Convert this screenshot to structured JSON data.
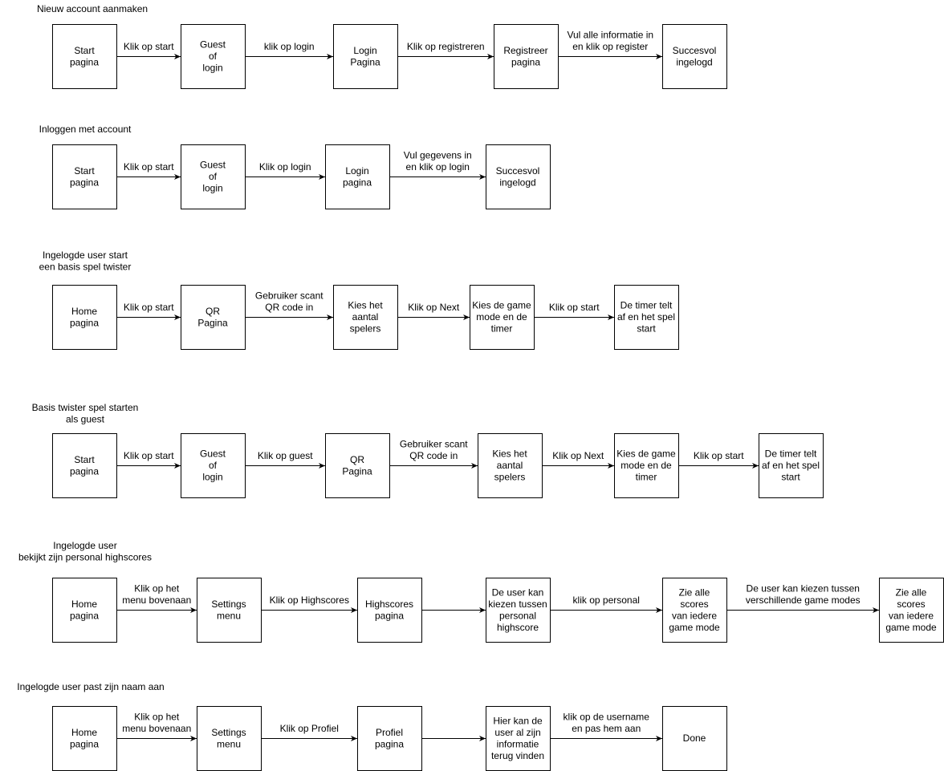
{
  "colors": {
    "stroke": "#000000",
    "box_fill": "#ffffff",
    "text": "#000000",
    "background": "#ffffff"
  },
  "flows": [
    {
      "id": "new-account",
      "title": [
        "Nieuw account aanmaken"
      ],
      "nodes": [
        {
          "id": "start",
          "label": [
            "Start",
            "pagina"
          ]
        },
        {
          "id": "guest-login",
          "label": [
            "Guest",
            "of",
            "login"
          ]
        },
        {
          "id": "login-page",
          "label": [
            "Login",
            "Pagina"
          ]
        },
        {
          "id": "register-page",
          "label": [
            "Registreer",
            "pagina"
          ]
        },
        {
          "id": "logged-in",
          "label": [
            "Succesvol",
            "ingelogd"
          ]
        }
      ],
      "edges": [
        {
          "from": "start",
          "to": "guest-login",
          "label": [
            "Klik op start"
          ]
        },
        {
          "from": "guest-login",
          "to": "login-page",
          "label": [
            "klik op login"
          ]
        },
        {
          "from": "login-page",
          "to": "register-page",
          "label": [
            "Klik op registreren"
          ]
        },
        {
          "from": "register-page",
          "to": "logged-in",
          "label": [
            "Vul alle informatie in",
            "en klik op register"
          ]
        }
      ]
    },
    {
      "id": "login-account",
      "title": [
        "Inloggen met account"
      ],
      "nodes": [
        {
          "id": "start",
          "label": [
            "Start",
            "pagina"
          ]
        },
        {
          "id": "guest-login",
          "label": [
            "Guest",
            "of",
            "login"
          ]
        },
        {
          "id": "login-page",
          "label": [
            "Login",
            "pagina"
          ]
        },
        {
          "id": "logged-in",
          "label": [
            "Succesvol",
            "ingelogd"
          ]
        }
      ],
      "edges": [
        {
          "from": "start",
          "to": "guest-login",
          "label": [
            "Klik op start"
          ]
        },
        {
          "from": "guest-login",
          "to": "login-page",
          "label": [
            "Klik op login"
          ]
        },
        {
          "from": "login-page",
          "to": "logged-in",
          "label": [
            "Vul gegevens in",
            "en klik op login"
          ]
        }
      ]
    },
    {
      "id": "user-start-game",
      "title": [
        "Ingelogde user start",
        "een basis spel twister"
      ],
      "nodes": [
        {
          "id": "home",
          "label": [
            "Home",
            "pagina"
          ]
        },
        {
          "id": "qr",
          "label": [
            "QR",
            "Pagina"
          ]
        },
        {
          "id": "players",
          "label": [
            "Kies het",
            "aantal",
            "spelers"
          ]
        },
        {
          "id": "mode",
          "label": [
            "Kies de game",
            "mode en de",
            "timer"
          ]
        },
        {
          "id": "timer",
          "label": [
            "De timer telt",
            "af en het spel",
            "start"
          ]
        }
      ],
      "edges": [
        {
          "from": "home",
          "to": "qr",
          "label": [
            "Klik op start"
          ]
        },
        {
          "from": "qr",
          "to": "players",
          "label": [
            "Gebruiker scant",
            "QR code in"
          ]
        },
        {
          "from": "players",
          "to": "mode",
          "label": [
            "Klik op Next"
          ]
        },
        {
          "from": "mode",
          "to": "timer",
          "label": [
            "Klik op start"
          ]
        }
      ]
    },
    {
      "id": "guest-start-game",
      "title": [
        "Basis twister spel starten",
        "als guest"
      ],
      "nodes": [
        {
          "id": "start",
          "label": [
            "Start",
            "pagina"
          ]
        },
        {
          "id": "guest-login",
          "label": [
            "Guest",
            "of",
            "login"
          ]
        },
        {
          "id": "qr",
          "label": [
            "QR",
            "Pagina"
          ]
        },
        {
          "id": "players",
          "label": [
            "Kies het",
            "aantal",
            "spelers"
          ]
        },
        {
          "id": "mode",
          "label": [
            "Kies de game",
            "mode en de",
            "timer"
          ]
        },
        {
          "id": "timer",
          "label": [
            "De timer telt",
            "af en het spel",
            "start"
          ]
        }
      ],
      "edges": [
        {
          "from": "start",
          "to": "guest-login",
          "label": [
            "Klik op start"
          ]
        },
        {
          "from": "guest-login",
          "to": "qr",
          "label": [
            "Klik op guest"
          ]
        },
        {
          "from": "qr",
          "to": "players",
          "label": [
            "Gebruiker scant",
            "QR code in"
          ]
        },
        {
          "from": "players",
          "to": "mode",
          "label": [
            "Klik op Next"
          ]
        },
        {
          "from": "mode",
          "to": "timer",
          "label": [
            "Klik op start"
          ]
        }
      ]
    },
    {
      "id": "user-highscores",
      "title": [
        "Ingelogde user",
        "bekijkt zijn personal highscores"
      ],
      "nodes": [
        {
          "id": "home",
          "label": [
            "Home",
            "pagina"
          ]
        },
        {
          "id": "settings",
          "label": [
            "Settings",
            "menu"
          ]
        },
        {
          "id": "highscores",
          "label": [
            "Highscores",
            "pagina"
          ]
        },
        {
          "id": "choose-personal",
          "label": [
            "De user kan",
            "kiezen tussen",
            "personal",
            "highscore"
          ]
        },
        {
          "id": "scores-1",
          "label": [
            "Zie alle",
            "scores",
            "van iedere",
            "game mode"
          ]
        },
        {
          "id": "scores-2",
          "label": [
            "Zie alle",
            "scores",
            "van iedere",
            "game mode"
          ]
        }
      ],
      "edges": [
        {
          "from": "home",
          "to": "settings",
          "label": [
            "Klik op het",
            "menu bovenaan"
          ]
        },
        {
          "from": "settings",
          "to": "highscores",
          "label": [
            "Klik op Highscores"
          ]
        },
        {
          "from": "highscores",
          "to": "choose-personal",
          "label": []
        },
        {
          "from": "choose-personal",
          "to": "scores-1",
          "label": [
            "klik op personal"
          ]
        },
        {
          "from": "scores-1",
          "to": "scores-2",
          "label": [
            "De user kan kiezen tussen",
            "verschillende game modes"
          ]
        }
      ]
    },
    {
      "id": "user-rename",
      "title": [
        "Ingelogde user past zijn naam aan"
      ],
      "nodes": [
        {
          "id": "home",
          "label": [
            "Home",
            "pagina"
          ]
        },
        {
          "id": "settings",
          "label": [
            "Settings",
            "menu"
          ]
        },
        {
          "id": "profile",
          "label": [
            "Profiel",
            "pagina"
          ]
        },
        {
          "id": "info",
          "label": [
            "Hier kan de",
            "user al zijn",
            "informatie",
            "terug vinden"
          ]
        },
        {
          "id": "done",
          "label": [
            "Done"
          ]
        }
      ],
      "edges": [
        {
          "from": "home",
          "to": "settings",
          "label": [
            "Klik op het",
            "menu bovenaan"
          ]
        },
        {
          "from": "settings",
          "to": "profile",
          "label": [
            "Klik op Profiel"
          ]
        },
        {
          "from": "profile",
          "to": "info",
          "label": []
        },
        {
          "from": "info",
          "to": "done",
          "label": [
            "klik op de username",
            "en pas hem aan"
          ]
        }
      ]
    }
  ]
}
